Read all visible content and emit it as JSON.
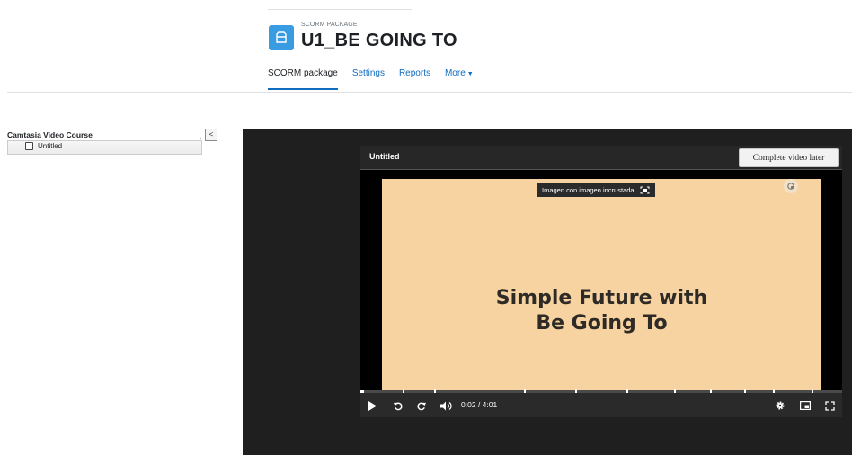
{
  "header": {
    "kicker": "SCORM PACKAGE",
    "title": "U1_BE GOING TO",
    "tabs": [
      {
        "label": "SCORM package",
        "active": true
      },
      {
        "label": "Settings"
      },
      {
        "label": "Reports"
      },
      {
        "label": "More"
      }
    ]
  },
  "sidebar": {
    "title": "Camtasia Video Course",
    "collapse_label": "<",
    "items": [
      {
        "label": "Untitled"
      }
    ]
  },
  "player": {
    "title": "Untitled",
    "complete_button": "Complete video later",
    "pip_tooltip": "Imagen con imagen incrustada",
    "slide_title_line1": "Simple Future with",
    "slide_title_line2": "Be Going To",
    "time": "0:02 / 4:01",
    "progress_fraction": 0.008,
    "controls": [
      "play-icon",
      "rewind-icon",
      "forward-icon",
      "volume-icon",
      "settings-icon",
      "pip-icon",
      "fullscreen-icon"
    ]
  },
  "colors": {
    "accent": "#0f6cbf",
    "package_icon": "#399be2",
    "slide_bg": "#f6d3a1",
    "player_bg": "#1f1f1f"
  }
}
